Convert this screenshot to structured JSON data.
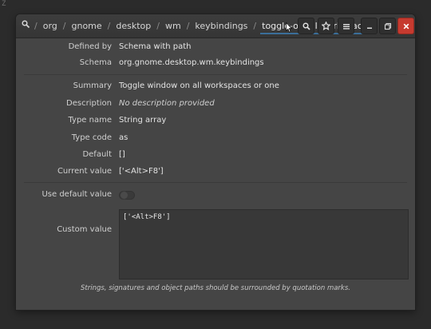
{
  "background": {
    "corner_text": "Z",
    "color": "#2b2b2b"
  },
  "breadcrumbs": [
    "org",
    "gnome",
    "desktop",
    "wm",
    "keybindings",
    "toggle-on-all-workspaces"
  ],
  "breadcrumb_separator": "/",
  "header_buttons": [
    {
      "name": "search-icon"
    },
    {
      "name": "star-icon"
    },
    {
      "name": "menu-icon"
    },
    {
      "name": "minimize-icon"
    },
    {
      "name": "maximize-icon"
    },
    {
      "name": "close-icon"
    }
  ],
  "properties": {
    "defined_by": {
      "label": "Defined by",
      "value": "Schema with path"
    },
    "schema": {
      "label": "Schema",
      "value": "org.gnome.desktop.wm.keybindings"
    },
    "summary": {
      "label": "Summary",
      "value": "Toggle window on all workspaces or one"
    },
    "description": {
      "label": "Description",
      "value": "No description provided"
    },
    "type_name": {
      "label": "Type name",
      "value": "String array"
    },
    "type_code": {
      "label": "Type code",
      "value": "as"
    },
    "default": {
      "label": "Default",
      "value": "[]"
    },
    "current_value": {
      "label": "Current value",
      "value": "['<Alt>F8']"
    }
  },
  "use_default": {
    "label": "Use default value",
    "checked": false
  },
  "custom_value": {
    "label": "Custom value",
    "text": "['<Alt>F8']"
  },
  "footer_note": "Strings, signatures and object paths should be surrounded by quotation marks.",
  "colors": {
    "accent": "#3a6e99",
    "close_button": "#c63a2f",
    "window": "#454545"
  }
}
